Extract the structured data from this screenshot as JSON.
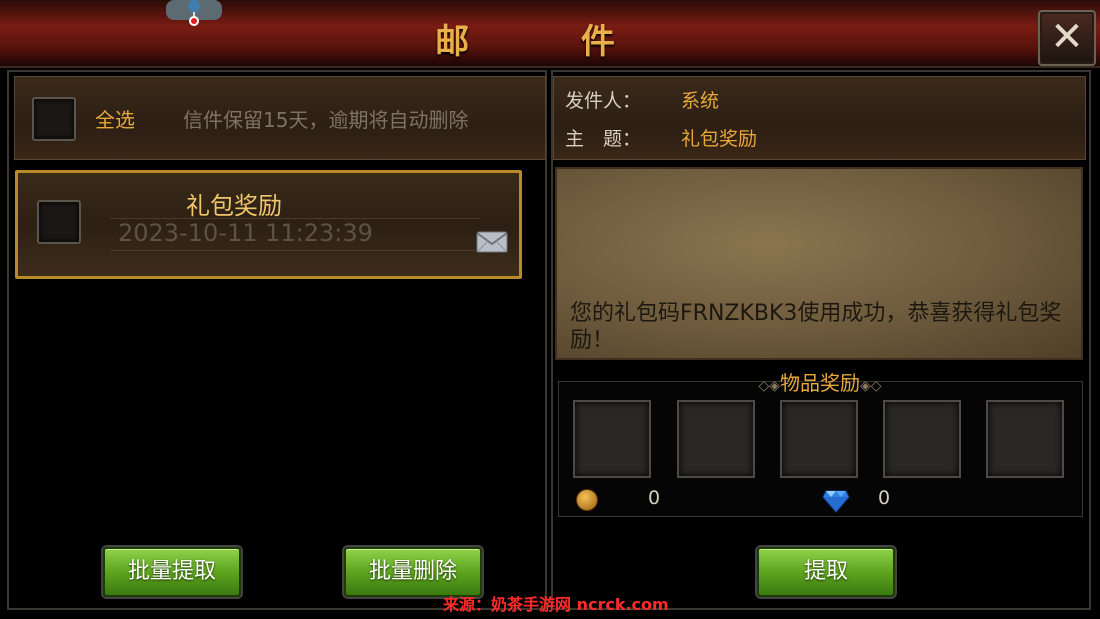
{
  "window": {
    "title": "邮 件"
  },
  "left_panel": {
    "select_all_label": "全选",
    "retention_note": "信件保留15天，逾期将自动删除",
    "mails": [
      {
        "title": "礼包奖励",
        "date": "2023-10-11 11:23:39"
      }
    ],
    "batch_claim_label": "批量提取",
    "batch_delete_label": "批量删除"
  },
  "detail": {
    "sender_label": "发件人：",
    "sender_value": "系统",
    "subject_label": "主　题：",
    "subject_value": "礼包奖励",
    "body": "您的礼包码FRNZKBK3使用成功，恭喜获得礼包奖励！",
    "rewards_title": "物品奖励",
    "gold_amount": "0",
    "diamond_amount": "0",
    "claim_label": "提取"
  },
  "watermark": "来源：奶茶手游网 ncrck.com",
  "colors": {
    "accent": "#e6a83a",
    "button_green": "#5ea41f",
    "title_red": "#7a1c12"
  },
  "icons": [
    "close-icon",
    "envelope-icon",
    "gold-coin-icon",
    "diamond-icon",
    "pin-icon"
  ]
}
